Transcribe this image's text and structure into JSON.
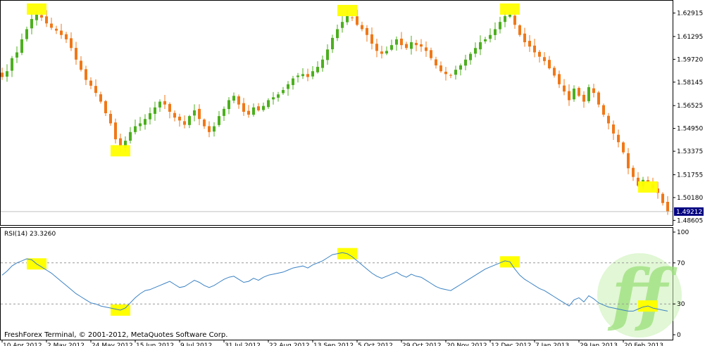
{
  "footer_text": "FreshForex Terminal, © 2001-2012, MetaQuotes Software Corp.",
  "logo_text": "ff",
  "colors": {
    "bull": "#4caf1e",
    "bear": "#f07818",
    "rsi": "#3b82c4",
    "highlight": "#ffff00",
    "price_tag_bg": "#000080",
    "logo": "#9be07a"
  },
  "chart_data": [
    {
      "type": "candlestick",
      "title": "",
      "current_price_label": "1.49212",
      "y_ticks": [
        "1.62915",
        "1.61295",
        "1.59720",
        "1.58145",
        "1.56525",
        "1.54950",
        "1.53375",
        "1.51755",
        "1.50180",
        "1.48605"
      ],
      "ylim": [
        1.4838,
        1.6362
      ],
      "x_ticks": [
        "10 Apr 2012",
        "2 May 2012",
        "24 May 2012",
        "15 Jun 2012",
        "9 Jul 2012",
        "31 Jul 2012",
        "22 Aug 2012",
        "13 Sep 2012",
        "5 Oct 2012",
        "29 Oct 2012",
        "20 Nov 2012",
        "12 Dec 2012",
        "7 Jan 2013",
        "29 Jan 2013",
        "20 Feb 2013"
      ],
      "close_series": [
        1.585,
        1.589,
        1.598,
        1.602,
        1.611,
        1.618,
        1.625,
        1.628,
        1.626,
        1.622,
        1.619,
        1.617,
        1.614,
        1.611,
        1.605,
        1.597,
        1.59,
        1.583,
        1.579,
        1.574,
        1.568,
        1.56,
        1.553,
        1.542,
        1.537,
        1.541,
        1.547,
        1.551,
        1.553,
        1.556,
        1.56,
        1.564,
        1.568,
        1.566,
        1.561,
        1.557,
        1.555,
        1.552,
        1.558,
        1.562,
        1.556,
        1.551,
        1.547,
        1.551,
        1.558,
        1.563,
        1.569,
        1.572,
        1.566,
        1.561,
        1.559,
        1.564,
        1.562,
        1.565,
        1.569,
        1.571,
        1.573,
        1.576,
        1.58,
        1.584,
        1.586,
        1.587,
        1.585,
        1.589,
        1.592,
        1.597,
        1.604,
        1.612,
        1.618,
        1.623,
        1.627,
        1.626,
        1.621,
        1.618,
        1.614,
        1.608,
        1.603,
        1.601,
        1.603,
        1.607,
        1.611,
        1.607,
        1.605,
        1.609,
        1.607,
        1.606,
        1.603,
        1.598,
        1.593,
        1.589,
        1.587,
        1.586,
        1.59,
        1.593,
        1.597,
        1.601,
        1.605,
        1.609,
        1.611,
        1.614,
        1.618,
        1.623,
        1.627,
        1.628,
        1.621,
        1.614,
        1.609,
        1.606,
        1.602,
        1.599,
        1.596,
        1.591,
        1.586,
        1.58,
        1.575,
        1.569,
        1.577,
        1.572,
        1.568,
        1.578,
        1.574,
        1.566,
        1.559,
        1.553,
        1.546,
        1.54,
        1.533,
        1.522,
        1.516,
        1.51,
        1.514,
        1.512,
        1.508,
        1.505,
        1.498,
        1.4921
      ],
      "highlighted_extremes": [
        {
          "label": "peak",
          "index": 7
        },
        {
          "label": "trough",
          "index": 24
        },
        {
          "label": "peak",
          "index": 70
        },
        {
          "label": "peak",
          "index": 103
        },
        {
          "label": "trough",
          "index": 131
        }
      ]
    },
    {
      "type": "line",
      "title": "RSI(14) 23.3260",
      "y_ticks": [
        "100",
        "70",
        "30",
        "0"
      ],
      "ylim": [
        0,
        100
      ],
      "levels": [
        70,
        30
      ],
      "values": [
        58,
        62,
        67,
        70,
        72,
        74,
        73,
        69,
        66,
        63,
        60,
        56,
        52,
        48,
        44,
        40,
        37,
        34,
        31,
        30,
        28,
        27,
        26,
        25,
        24,
        26,
        31,
        36,
        40,
        43,
        44,
        46,
        48,
        50,
        52,
        49,
        46,
        47,
        50,
        53,
        51,
        48,
        46,
        48,
        51,
        54,
        56,
        57,
        54,
        51,
        52,
        55,
        53,
        56,
        58,
        59,
        60,
        61,
        63,
        65,
        66,
        67,
        65,
        68,
        70,
        72,
        75,
        78,
        79,
        80,
        79,
        76,
        72,
        68,
        64,
        60,
        57,
        55,
        57,
        59,
        61,
        58,
        56,
        59,
        57,
        56,
        53,
        50,
        47,
        45,
        44,
        43,
        46,
        49,
        52,
        55,
        58,
        61,
        64,
        66,
        68,
        70,
        72,
        71,
        64,
        58,
        54,
        51,
        48,
        45,
        43,
        40,
        37,
        34,
        31,
        28,
        34,
        36,
        32,
        38,
        35,
        31,
        29,
        27,
        26,
        25,
        24,
        23,
        23,
        25,
        27,
        28,
        26,
        25,
        24,
        23
      ]
    }
  ]
}
